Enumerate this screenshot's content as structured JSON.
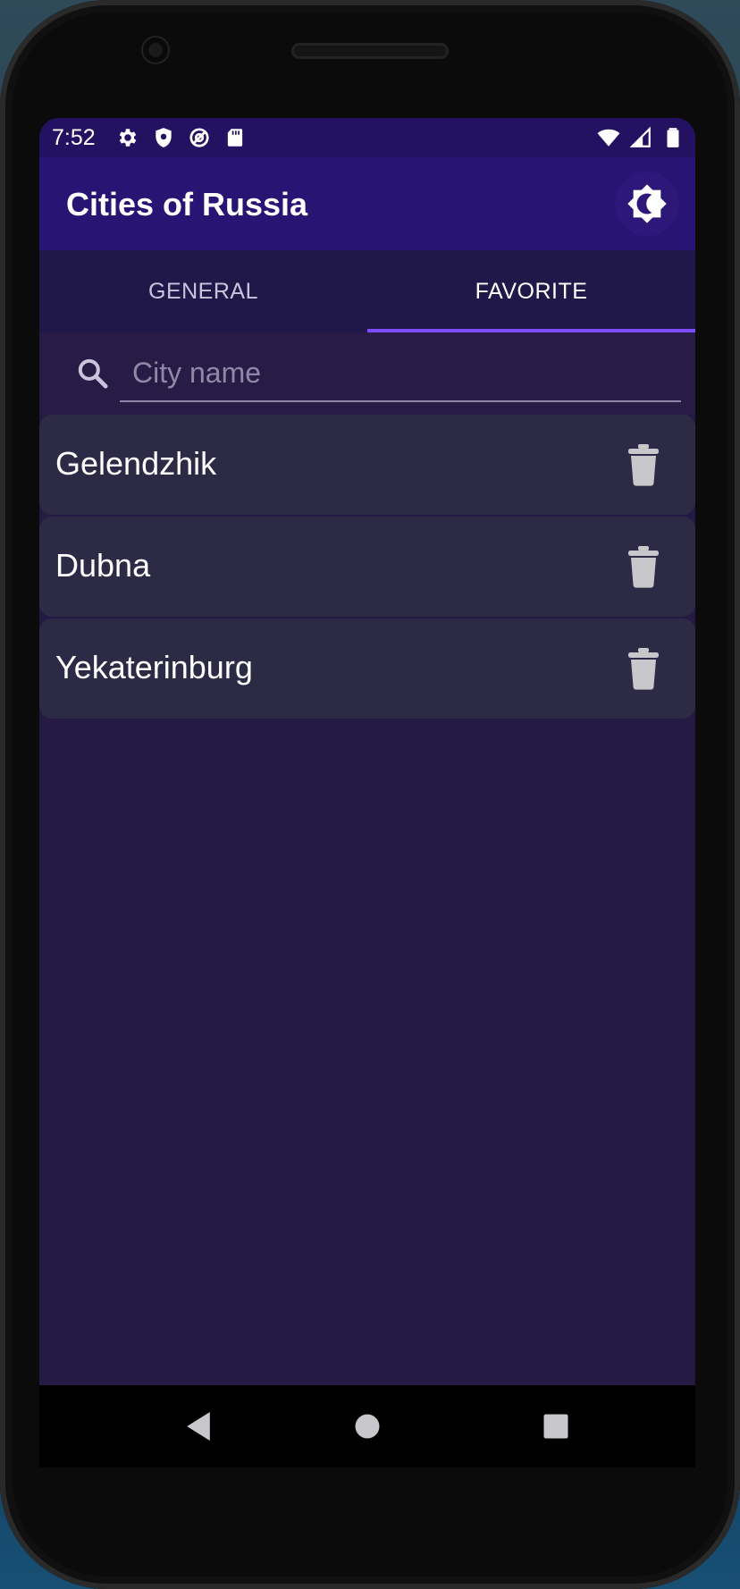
{
  "status_bar": {
    "time": "7:52",
    "left_icons": [
      "gear-icon",
      "shield-icon",
      "data-saver-icon",
      "sd-card-icon"
    ],
    "right_icons": [
      "wifi-icon",
      "cellular-icon",
      "battery-icon"
    ]
  },
  "app_bar": {
    "title": "Cities of Russia",
    "theme_toggle_icon": "brightness-icon"
  },
  "tabs": [
    {
      "label": "GENERAL",
      "selected": false
    },
    {
      "label": "FAVORITE",
      "selected": true
    }
  ],
  "search": {
    "placeholder": "City name",
    "value": "",
    "icon": "search-icon"
  },
  "favorites": [
    {
      "name": "Gelendzhik",
      "action_icon": "trash-icon"
    },
    {
      "name": "Dubna",
      "action_icon": "trash-icon"
    },
    {
      "name": "Yekaterinburg",
      "action_icon": "trash-icon"
    }
  ],
  "nav_bar": {
    "buttons": [
      "back-icon",
      "home-icon",
      "recents-icon"
    ]
  },
  "colors": {
    "status_bar": "#231261",
    "app_bar": "#281473",
    "background": "#241a43",
    "tab_indicator": "#7c4dff",
    "list_item": "#2c2a44"
  }
}
